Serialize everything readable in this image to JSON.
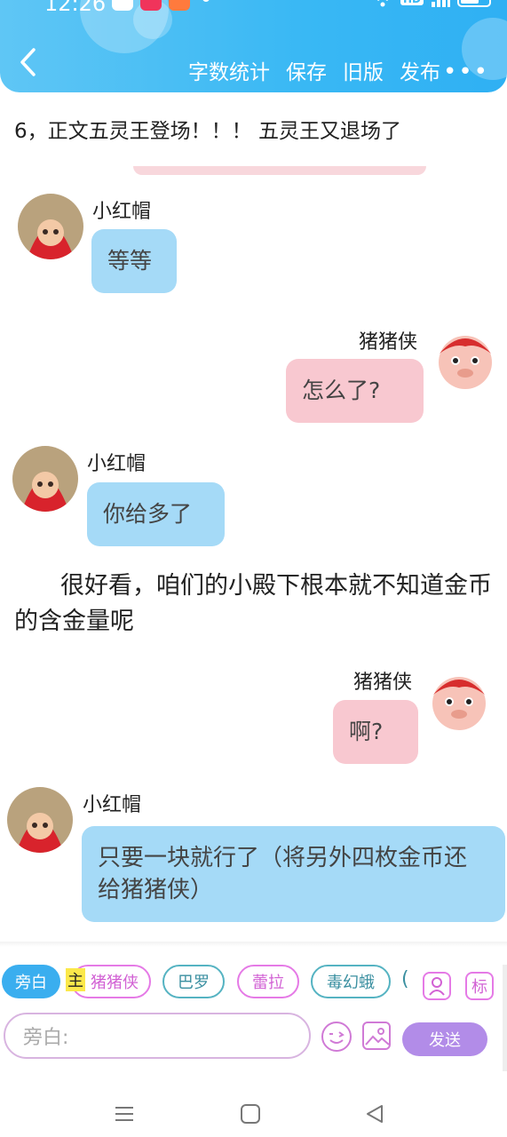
{
  "status": {
    "time": "12:26",
    "hd": "HD"
  },
  "header": {
    "menu": [
      "字数统计",
      "保存",
      "旧版",
      "发布"
    ],
    "more": "•••"
  },
  "content": {
    "line1": "6，正文五灵王登场！！！ 五灵王又退场了",
    "messages": [
      {
        "side": "left",
        "name": "小红帽",
        "text": "等等"
      },
      {
        "side": "right",
        "name": "猪猪侠",
        "text": "怎么了?"
      },
      {
        "side": "left",
        "name": "小红帽",
        "text": "你给多了"
      },
      {
        "side": "right",
        "name": "猪猪侠",
        "text": "啊?"
      },
      {
        "side": "left",
        "name": "小红帽",
        "text": "只要一块就行了（将另外四枚金币还给猪猪侠）"
      }
    ],
    "narration": "很好看，咱们的小殿下根本就不知道金币的含金量呢"
  },
  "composer": {
    "chips": [
      "旁白",
      "猪猪侠",
      "巴罗",
      "蕾拉",
      "毒幻蛾"
    ],
    "chip_prefix": "主",
    "paren": "(",
    "mark_label": "标",
    "placeholder": "旁白:",
    "send": "发送"
  },
  "colors": {
    "header": "#39b8f4",
    "bubble_blue": "#a5daf7",
    "bubble_pink": "#f8c8d0",
    "send": "#b28ce8"
  }
}
